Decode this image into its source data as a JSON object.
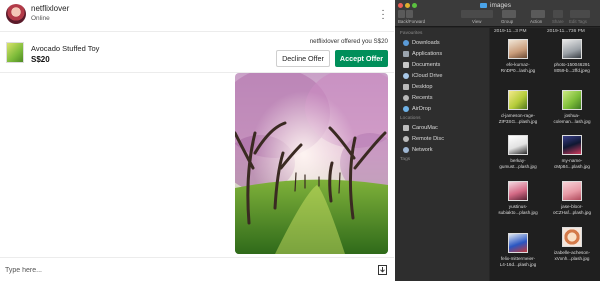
{
  "chat": {
    "user": {
      "name": "netflixlover",
      "status": "Online",
      "more_icon": "more-vertical-icon"
    },
    "listing": {
      "title": "Avocado Stuffed Toy",
      "price": "S$20"
    },
    "offer": {
      "message": "netflixlover offered you S$20",
      "decline_label": "Decline Offer",
      "accept_label": "Accept Offer"
    },
    "composer": {
      "placeholder": "Type here...",
      "send_icon": "send-icon"
    }
  },
  "finder": {
    "window_title": "images",
    "toolbar": {
      "back_forward": "Back/Forward",
      "view": "View",
      "group": "Group",
      "action": "Action",
      "share": "Share",
      "edit_tags": "Edit Tags"
    },
    "sidebar": {
      "favourites_header": "Favourites",
      "favourites": [
        "Downloads",
        "Applications",
        "Documents",
        "iCloud Drive",
        "Desktop",
        "Recents",
        "AirDrop"
      ],
      "locations_header": "Locations",
      "locations": [
        "CarouMac",
        "Remote Disc",
        "Network"
      ],
      "tags_header": "Tags"
    },
    "column_headers": [
      "2019-11...3 PM",
      "2019-11...736 PM"
    ],
    "files": [
      "efe-kurnaz-\nRnDP0...lash.jpg",
      "photo-150046291\n8059-b...2ffd.jpeg",
      "d-jameson-rage-\nZIP3SG...plash.jpg",
      "joshua-\ncoleman...lash.jpg",
      "berkay-\ngumust...plash.jpg",
      "my-name-\ncMp84...plash.jpg",
      "yustinus-\nsubiakto...plash.jpg",
      "jase-bloor-\noCZHaf...plash.jpg",
      "felix-mittermeier-\nL4-16d...plash.jpg",
      "izabelle-acheson-\nxVxnh...plash.jpg"
    ],
    "colors": {
      "accept_green": "#008f5a",
      "folder_blue": "#4aa3e8"
    }
  }
}
